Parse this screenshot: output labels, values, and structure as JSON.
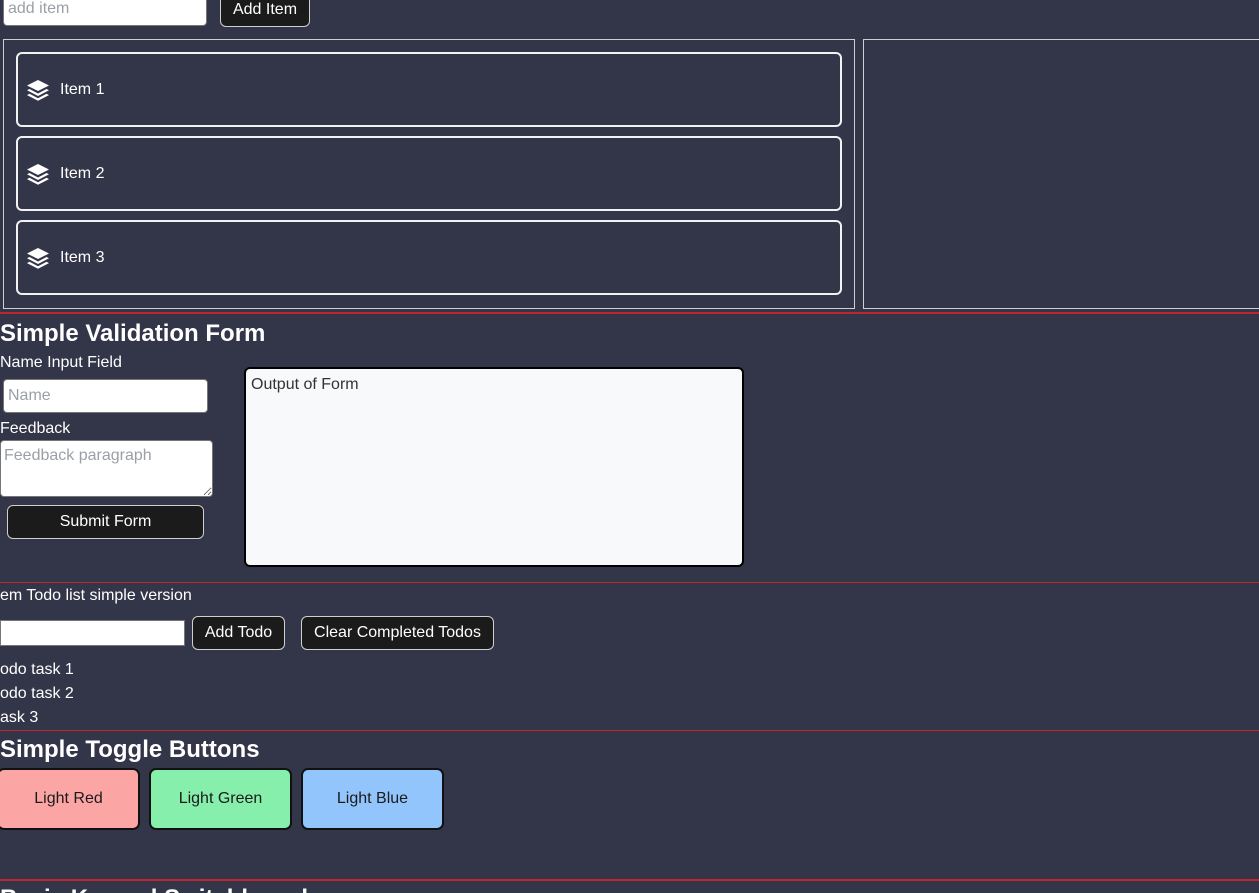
{
  "top_form": {
    "input_placeholder": "add item",
    "add_button_label": "Add Item"
  },
  "item_list": {
    "items": [
      {
        "label": "Item 1",
        "icon": "layers-icon"
      },
      {
        "label": "Item 2",
        "icon": "layers-icon"
      },
      {
        "label": "Item 3",
        "icon": "layers-icon"
      }
    ]
  },
  "validation_form": {
    "title": "Simple Validation Form",
    "name_label": "Name Input Field",
    "name_placeholder": "Name",
    "feedback_label": "Feedback",
    "feedback_placeholder": "Feedback paragraph",
    "submit_label": "Submit Form",
    "output_text": "Output of Form"
  },
  "todo": {
    "title": "em Todo list simple version",
    "add_label": "Add Todo",
    "clear_label": "Clear Completed Todos",
    "tasks": [
      "odo task 1",
      "odo task 2",
      "ask 3"
    ]
  },
  "toggles": {
    "title": "Simple Toggle Buttons",
    "buttons": [
      {
        "label": "Light Red",
        "color": "#fca5a5"
      },
      {
        "label": "Light Green",
        "color": "#86efac"
      },
      {
        "label": "Light Blue",
        "color": "#93c5fd"
      }
    ]
  },
  "next_section": {
    "title": "Basic Keypad Switchboard"
  },
  "colors": {
    "background": "#333548",
    "separator": "#c0262e",
    "button_dark": "#1b1b1b"
  }
}
